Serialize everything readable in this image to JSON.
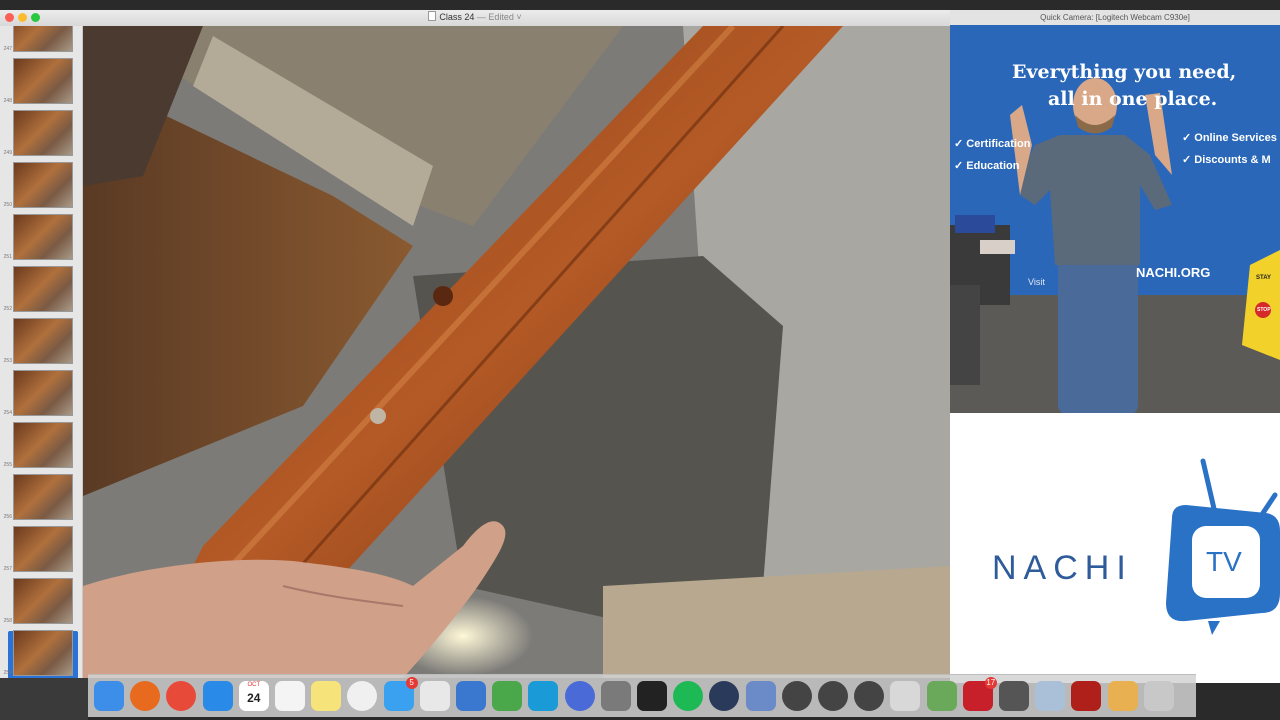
{
  "keynote_window": {
    "title": "Class 24",
    "title_status": "— Edited ˅",
    "thumbnails": [
      {
        "number": "247"
      },
      {
        "number": "248"
      },
      {
        "number": "249"
      },
      {
        "number": "250"
      },
      {
        "number": "251"
      },
      {
        "number": "252"
      },
      {
        "number": "253"
      },
      {
        "number": "254"
      },
      {
        "number": "255"
      },
      {
        "number": "256"
      },
      {
        "number": "257"
      },
      {
        "number": "258"
      },
      {
        "number": "259"
      }
    ]
  },
  "camera_window": {
    "title": "Quick Camera: [Logitech Webcam C930e]",
    "banner_headline_1": "Everything you need,",
    "banner_headline_2": "all in one place.",
    "banner_items_left": [
      "Certification",
      "Education"
    ],
    "banner_items_right": [
      "Online Services",
      "Discounts & M"
    ],
    "banner_url_prefix": "Visit",
    "banner_url": "NACHI.ORG",
    "sign_text_1": "STAY",
    "sign_text_2": "STOP"
  },
  "logo": {
    "text": "NACHI",
    "tv_text": "TV"
  },
  "dock": {
    "calendar_month": "OCT",
    "calendar_day": "24",
    "badges": {
      "messages": "5",
      "adobe": "17"
    },
    "apps": [
      "finder",
      "firefox",
      "chrome",
      "safari",
      "calendar",
      "textedit",
      "notes",
      "photos",
      "messages",
      "preview",
      "keynote",
      "numbers",
      "skype",
      "audio",
      "system-preferences",
      "final-cut",
      "spotify",
      "quicktime",
      "screenshot",
      "camera-1",
      "camera-2",
      "camera-3",
      "calculator",
      "user",
      "adobe-q",
      "script-editor",
      "scanner",
      "acrobat",
      "cookie",
      "trash"
    ]
  },
  "colors": {
    "accent_blue": "#2a72d6",
    "nachi_blue": "#2e5b9a",
    "banner_blue": "#2a67b8"
  }
}
